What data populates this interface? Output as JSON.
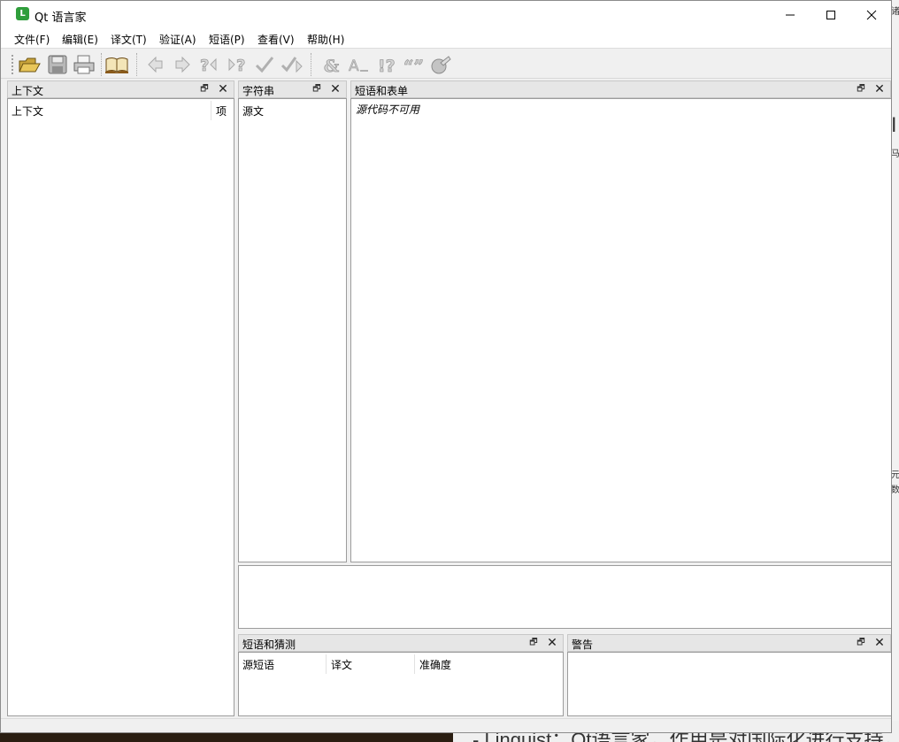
{
  "window": {
    "title": "Qt 语言家",
    "app_icon_letter": "L",
    "icon_color": "#2f9e3b"
  },
  "menu": [
    {
      "label": "文件(F)"
    },
    {
      "label": "编辑(E)"
    },
    {
      "label": "译文(T)"
    },
    {
      "label": "验证(A)"
    },
    {
      "label": "短语(P)"
    },
    {
      "label": "查看(V)"
    },
    {
      "label": "帮助(H)"
    }
  ],
  "toolbar": {
    "buttons": [
      {
        "icon": "open-folder-icon",
        "enabled": true
      },
      {
        "icon": "save-icon",
        "enabled": true
      },
      {
        "icon": "print-icon",
        "enabled": true
      },
      {
        "icon": "open-phrasebook-icon",
        "enabled": true
      },
      {
        "icon": "previous-icon",
        "enabled": false
      },
      {
        "icon": "next-icon",
        "enabled": false
      },
      {
        "icon": "previous-unfinished-icon",
        "enabled": false
      },
      {
        "icon": "next-unfinished-icon",
        "enabled": false
      },
      {
        "icon": "done-icon",
        "enabled": false
      },
      {
        "icon": "done-next-icon",
        "enabled": false
      },
      {
        "icon": "accelerators-icon",
        "enabled": false
      },
      {
        "icon": "surrounding-whitespace-icon",
        "enabled": false
      },
      {
        "icon": "punctuation-icon",
        "enabled": false
      },
      {
        "icon": "phrases-icon",
        "enabled": false
      },
      {
        "icon": "place-markers-icon",
        "enabled": false
      }
    ]
  },
  "context_dock": {
    "title": "上下文",
    "columns": [
      "上下文",
      "项"
    ]
  },
  "strings_dock": {
    "title": "字符串",
    "columns": [
      "源文"
    ]
  },
  "phrases_forms_dock": {
    "title": "短语和表单",
    "message": "源代码不可用"
  },
  "guesses_dock": {
    "title": "短语和猜测",
    "columns": [
      "源短语",
      "译文",
      "准确度"
    ]
  },
  "warnings_dock": {
    "title": "警告"
  },
  "background": {
    "bottom_text": "- Linguist：Qt语言家，作用是对国际化进行支持，"
  }
}
